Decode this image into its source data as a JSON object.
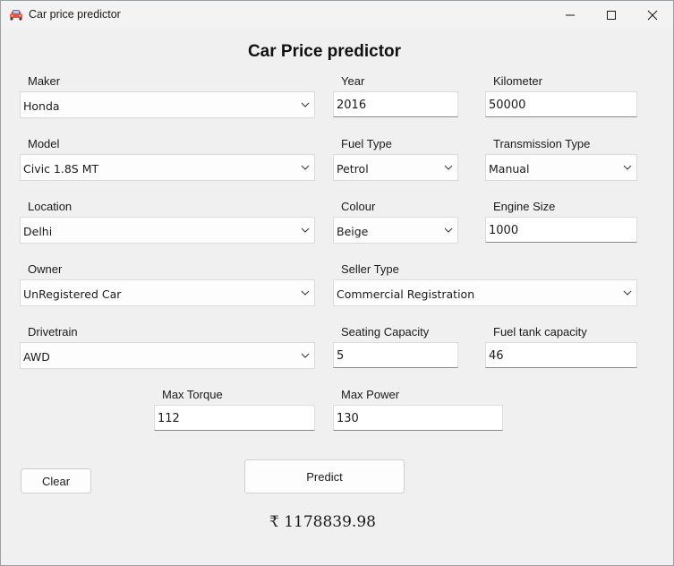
{
  "window": {
    "title": "Car price predictor",
    "app_icon": "car-icon"
  },
  "heading": "Car Price predictor",
  "fields": {
    "maker": {
      "label": "Maker",
      "value": "Honda"
    },
    "year": {
      "label": "Year",
      "value": "2016"
    },
    "kilometer": {
      "label": "Kilometer",
      "value": "50000"
    },
    "model": {
      "label": "Model",
      "value": "Civic 1.8S MT"
    },
    "fuel_type": {
      "label": "Fuel Type",
      "value": "Petrol"
    },
    "transmission": {
      "label": "Transmission Type",
      "value": "Manual"
    },
    "location": {
      "label": "Location",
      "value": "Delhi"
    },
    "colour": {
      "label": "Colour",
      "value": "Beige"
    },
    "engine_size": {
      "label": "Engine Size",
      "value": "1000"
    },
    "owner": {
      "label": "Owner",
      "value": "UnRegistered Car"
    },
    "seller_type": {
      "label": "Seller Type",
      "value": "Commercial Registration"
    },
    "drivetrain": {
      "label": "Drivetrain",
      "value": "AWD"
    },
    "seating": {
      "label": "Seating Capacity",
      "value": "5"
    },
    "fuel_tank": {
      "label": "Fuel tank capacity",
      "value": "46"
    },
    "max_torque": {
      "label": "Max Torque",
      "value": "112"
    },
    "max_power": {
      "label": "Max Power",
      "value": "130"
    }
  },
  "buttons": {
    "clear": "Clear",
    "predict": "Predict"
  },
  "result": "₹ 1178839.98"
}
